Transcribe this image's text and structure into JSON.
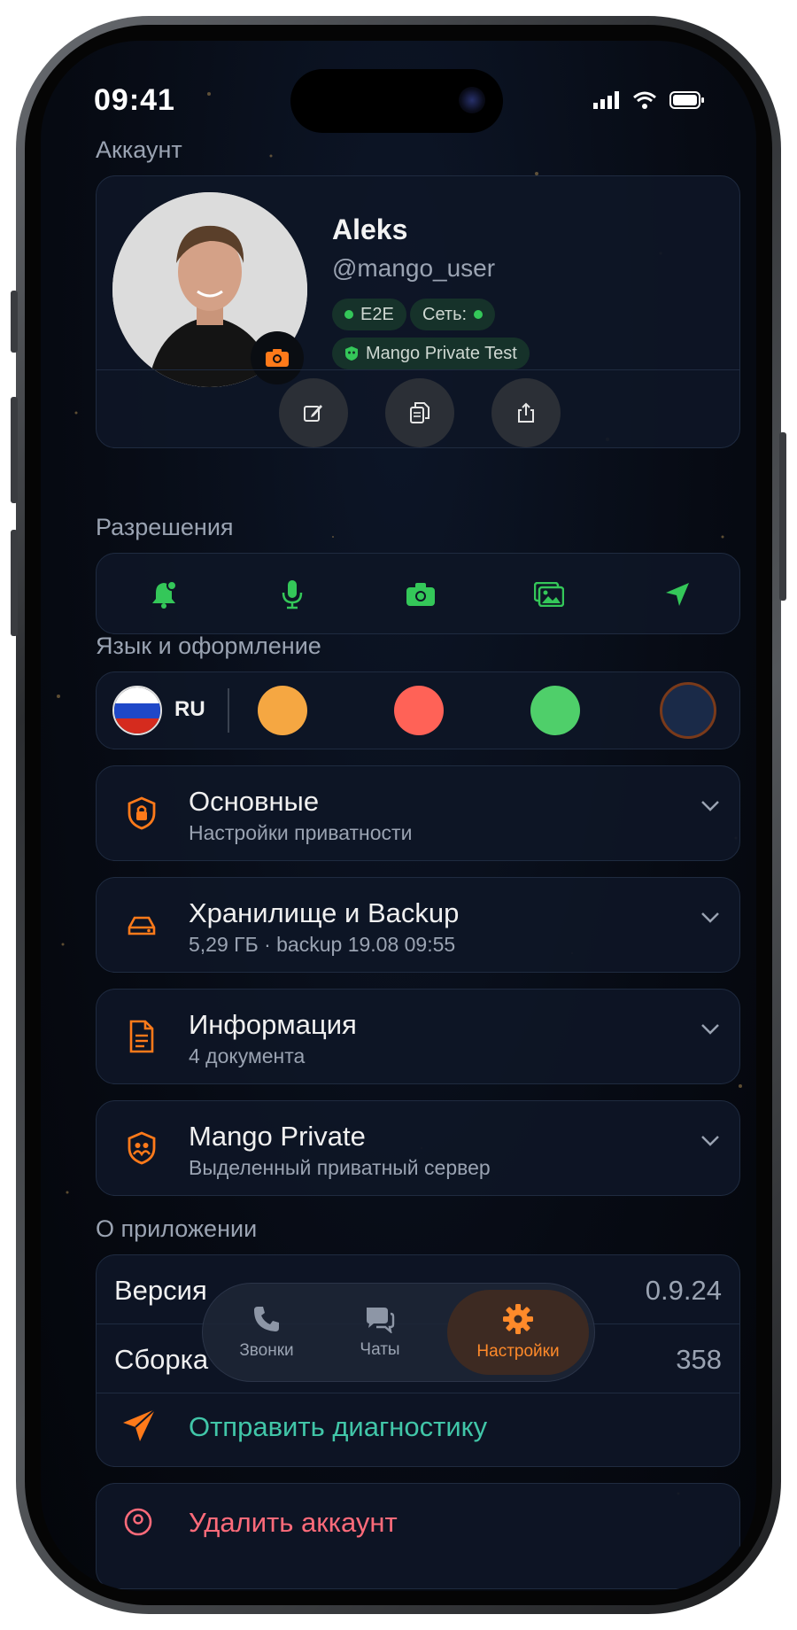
{
  "status_bar": {
    "time": "09:41"
  },
  "account": {
    "section_title": "Аккаунт",
    "name": "Aleks",
    "handle": "@mango_user",
    "chips": {
      "e2e": "E2E",
      "network": "Сеть:",
      "server": "Mango Private Test"
    },
    "actions": [
      "edit-icon",
      "copy-icon",
      "share-icon"
    ]
  },
  "permissions": {
    "section_title": "Разрешения",
    "items": [
      "notifications-icon",
      "microphone-icon",
      "camera-icon",
      "photos-icon",
      "location-icon"
    ]
  },
  "appearance": {
    "section_title": "Язык и оформление",
    "language_code": "RU",
    "themes": [
      {
        "name": "orange",
        "color": "#f5a742"
      },
      {
        "name": "red",
        "color": "#ff6257"
      },
      {
        "name": "green",
        "color": "#4fcf6a"
      },
      {
        "name": "navy",
        "color": "#1a2a48",
        "selected": true
      }
    ]
  },
  "settings_rows": [
    {
      "title": "Основные",
      "subtitle": "Настройки приватности",
      "icon": "shield-lock-icon"
    },
    {
      "title": "Хранилище и Backup",
      "subtitle": "5,29 ГБ · backup 19.08 09:55",
      "icon": "storage-drive-icon"
    },
    {
      "title": "Информация",
      "subtitle": "4 документа",
      "icon": "document-icon"
    },
    {
      "title": "Mango Private",
      "subtitle": "Выделенный приватный сервер",
      "icon": "private-server-icon"
    }
  ],
  "about": {
    "section_title": "О приложении",
    "version_label": "Версия",
    "version_value": "0.9.24",
    "build_label": "Сборка",
    "build_value": "358",
    "diagnostics": "Отправить диагностику"
  },
  "delete_account": "Удалить аккаунт",
  "tabbar": {
    "tabs": [
      {
        "label": "Звонки",
        "icon": "phone-icon"
      },
      {
        "label": "Чаты",
        "icon": "chats-icon"
      },
      {
        "label": "Настройки",
        "icon": "gear-icon",
        "active": true
      }
    ]
  },
  "colors": {
    "accent": "#ff7a1a",
    "online": "#34c759",
    "permission": "#34c759",
    "danger": "#ff6b7a",
    "link": "#41c6a8"
  }
}
